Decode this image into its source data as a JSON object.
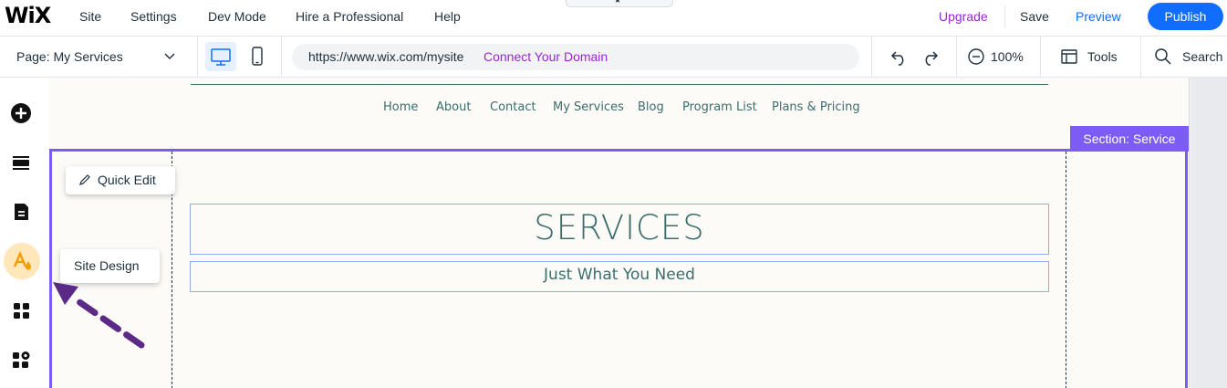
{
  "app": {
    "logo_text": "WiX"
  },
  "menu": {
    "items": [
      {
        "label": "Site"
      },
      {
        "label": "Settings"
      },
      {
        "label": "Dev Mode"
      },
      {
        "label": "Hire a Professional"
      },
      {
        "label": "Help"
      }
    ],
    "upgrade": "Upgrade",
    "save": "Save",
    "preview": "Preview",
    "publish": "Publish"
  },
  "toolbar": {
    "page_select": "Page: My Services",
    "url": "https://www.wix.com/mysite",
    "connect_domain": "Connect Your Domain",
    "zoom": "100%",
    "tools": "Tools",
    "search": "Search",
    "device_icons": [
      "desktop-icon",
      "mobile-icon"
    ],
    "history_icons": [
      "undo-icon",
      "redo-icon"
    ]
  },
  "rail": {
    "icons": [
      "add-elements-icon",
      "sections-icon",
      "pages-icon",
      "site-design-icon",
      "apps-icon",
      "business-tools-icon"
    ],
    "active": "site-design-icon"
  },
  "site": {
    "nav": [
      {
        "label": "Home"
      },
      {
        "label": "About"
      },
      {
        "label": "Contact"
      },
      {
        "label": "My Services"
      },
      {
        "label": "Blog"
      },
      {
        "label": "Program List"
      },
      {
        "label": "Plans & Pricing"
      }
    ],
    "section_tag": "Section: Service",
    "title": "SERVICES",
    "subtitle": "Just What You Need"
  },
  "tooltips": {
    "quick_edit": "Quick Edit",
    "site_design": "Site Design"
  },
  "colors": {
    "accent_blue": "#116dff",
    "upgrade_purple": "#9a27d5",
    "section_purple": "#7b5cf5",
    "site_text_teal": "#3b6d6a",
    "active_rail_bg": "#ffe7b9",
    "annotation_arrow": "#5b2a86"
  }
}
